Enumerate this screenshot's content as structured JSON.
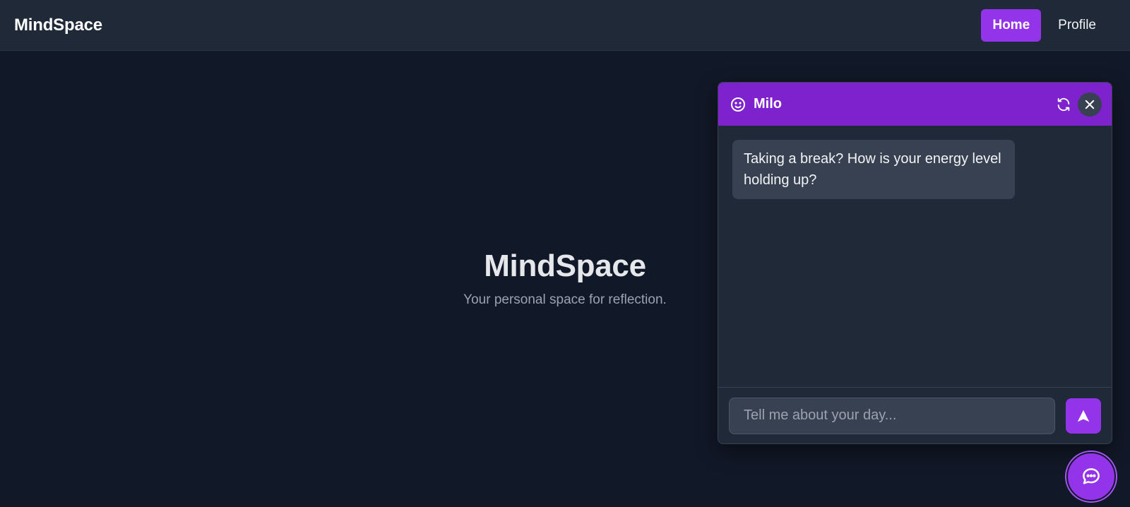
{
  "nav": {
    "brand": "MindSpace",
    "links": [
      {
        "label": "Home",
        "active": true
      },
      {
        "label": "Profile",
        "active": false
      }
    ]
  },
  "hero": {
    "title": "MindSpace",
    "subtitle": "Your personal space for reflection."
  },
  "chat": {
    "bot_name": "Milo",
    "icons": {
      "avatar": "smile-icon",
      "refresh": "refresh-icon",
      "close": "close-icon",
      "send": "send-icon",
      "launcher": "chat-bubble-icon"
    },
    "messages": [
      {
        "sender": "bot",
        "text": "Taking a break? How is your energy level holding up?"
      }
    ],
    "input": {
      "value": "",
      "placeholder": "Tell me about your day..."
    }
  },
  "colors": {
    "background": "#111827",
    "navbar": "#1f2937",
    "accent": "#9333ea",
    "chat_header": "#7e22ce",
    "bubble": "#374151",
    "muted_text": "#9ca3af"
  }
}
